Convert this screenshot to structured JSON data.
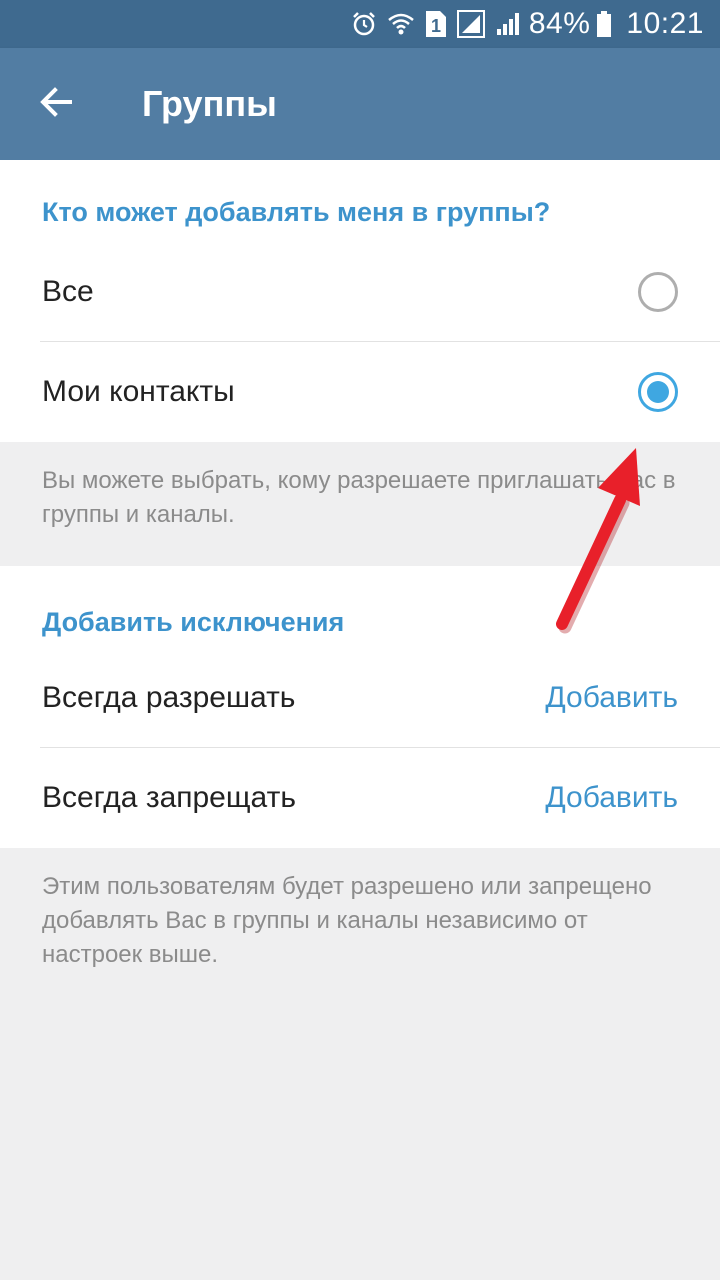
{
  "status_bar": {
    "battery": "84%",
    "time": "10:21",
    "sim_slot": "1",
    "icons": [
      "alarm-icon",
      "wifi-icon",
      "sim-icon",
      "signal-icon",
      "signal-icon",
      "battery-icon"
    ]
  },
  "app_bar": {
    "title": "Группы",
    "back_icon": "arrow-left-icon"
  },
  "who_can_add": {
    "header": "Кто может добавлять меня в группы?",
    "options": [
      {
        "label": "Все",
        "selected": false
      },
      {
        "label": "Мои контакты",
        "selected": true
      }
    ],
    "hint": "Вы можете выбрать, кому разрешаете приглашать Вас в группы и каналы."
  },
  "exceptions": {
    "header": "Добавить исключения",
    "rows": [
      {
        "label": "Всегда разрешать",
        "action": "Добавить"
      },
      {
        "label": "Всегда запрещать",
        "action": "Добавить"
      }
    ],
    "hint": "Этим пользователям будет разрешено или запрещено добавлять Вас в группы и каналы независимо от настроек выше."
  },
  "colors": {
    "status_bar": "#3f6a8f",
    "app_bar": "#527da3",
    "accent": "#3d93cc",
    "radio_checked": "#3fa7e1",
    "background": "#efeff0",
    "annotation_arrow": "#e8202a"
  }
}
